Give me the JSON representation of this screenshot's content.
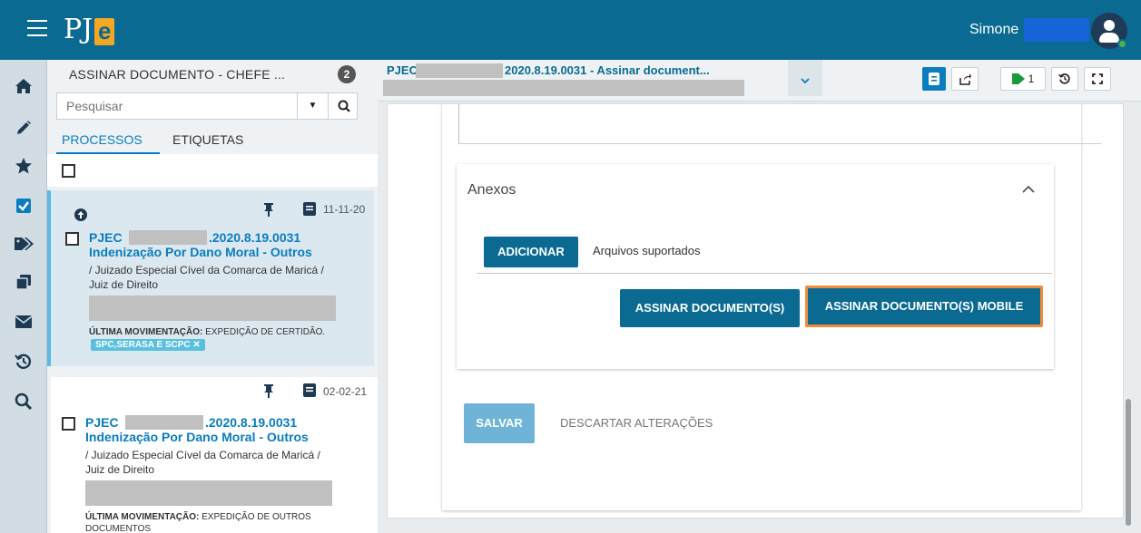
{
  "header": {
    "logo_text": "PJ",
    "logo_accent": "e",
    "user_name": "Simone",
    "brand_color": "#0a6a92"
  },
  "leftnav": {
    "icons": [
      "home-icon",
      "pencil-icon",
      "star-icon",
      "checkbox-icon",
      "tags-icon",
      "copy-icon",
      "envelope-icon",
      "history-icon",
      "search-icon"
    ]
  },
  "list": {
    "title": "ASSINAR DOCUMENTO - CHEFE ...",
    "count": "2",
    "search_placeholder": "Pesquisar",
    "tabs": [
      "PROCESSOS",
      "ETIQUETAS"
    ],
    "items": [
      {
        "date": "11-11-20",
        "number_prefix": "PJEC",
        "number_suffix": ".2020.8.19.0031",
        "class": "Indenização Por Dano Moral - Outros",
        "org_line1": "/ Juizado Especial Cível da Comarca de Maricá /",
        "org_line2": "Juiz de Direito",
        "movement_label": "ÚLTIMA MOVIMENTAÇÃO:",
        "movement_text": "EXPEDIÇÃO DE CERTIDÃO.",
        "tag": "SPC,SERASA E SCPC ✕"
      },
      {
        "date": "02-02-21",
        "number_prefix": "PJEC",
        "number_suffix": ".2020.8.19.0031",
        "class": "Indenização Por Dano Moral - Outros",
        "org_line1": "/ Juizado Especial Cível da Comarca de Maricá /",
        "org_line2": "Juiz de Direito",
        "movement_label": "ÚLTIMA MOVIMENTAÇÃO:",
        "movement_text": "EXPEDIÇÃO DE OUTROS",
        "movement_text2": "DOCUMENTOS"
      }
    ]
  },
  "main": {
    "prefix": "PJEC",
    "title": "2020.8.19.0031 - Assinar document...",
    "tag_count": "1",
    "anexos": {
      "title": "Anexos",
      "add_label": "ADICIONAR",
      "supported_label": "Arquivos suportados",
      "sign_label": "ASSINAR DOCUMENTO(S)",
      "sign_mobile_label": "ASSINAR DOCUMENTO(S) MOBILE"
    },
    "save_label": "SALVAR",
    "discard_label": "DESCARTAR ALTERAÇÕES"
  }
}
